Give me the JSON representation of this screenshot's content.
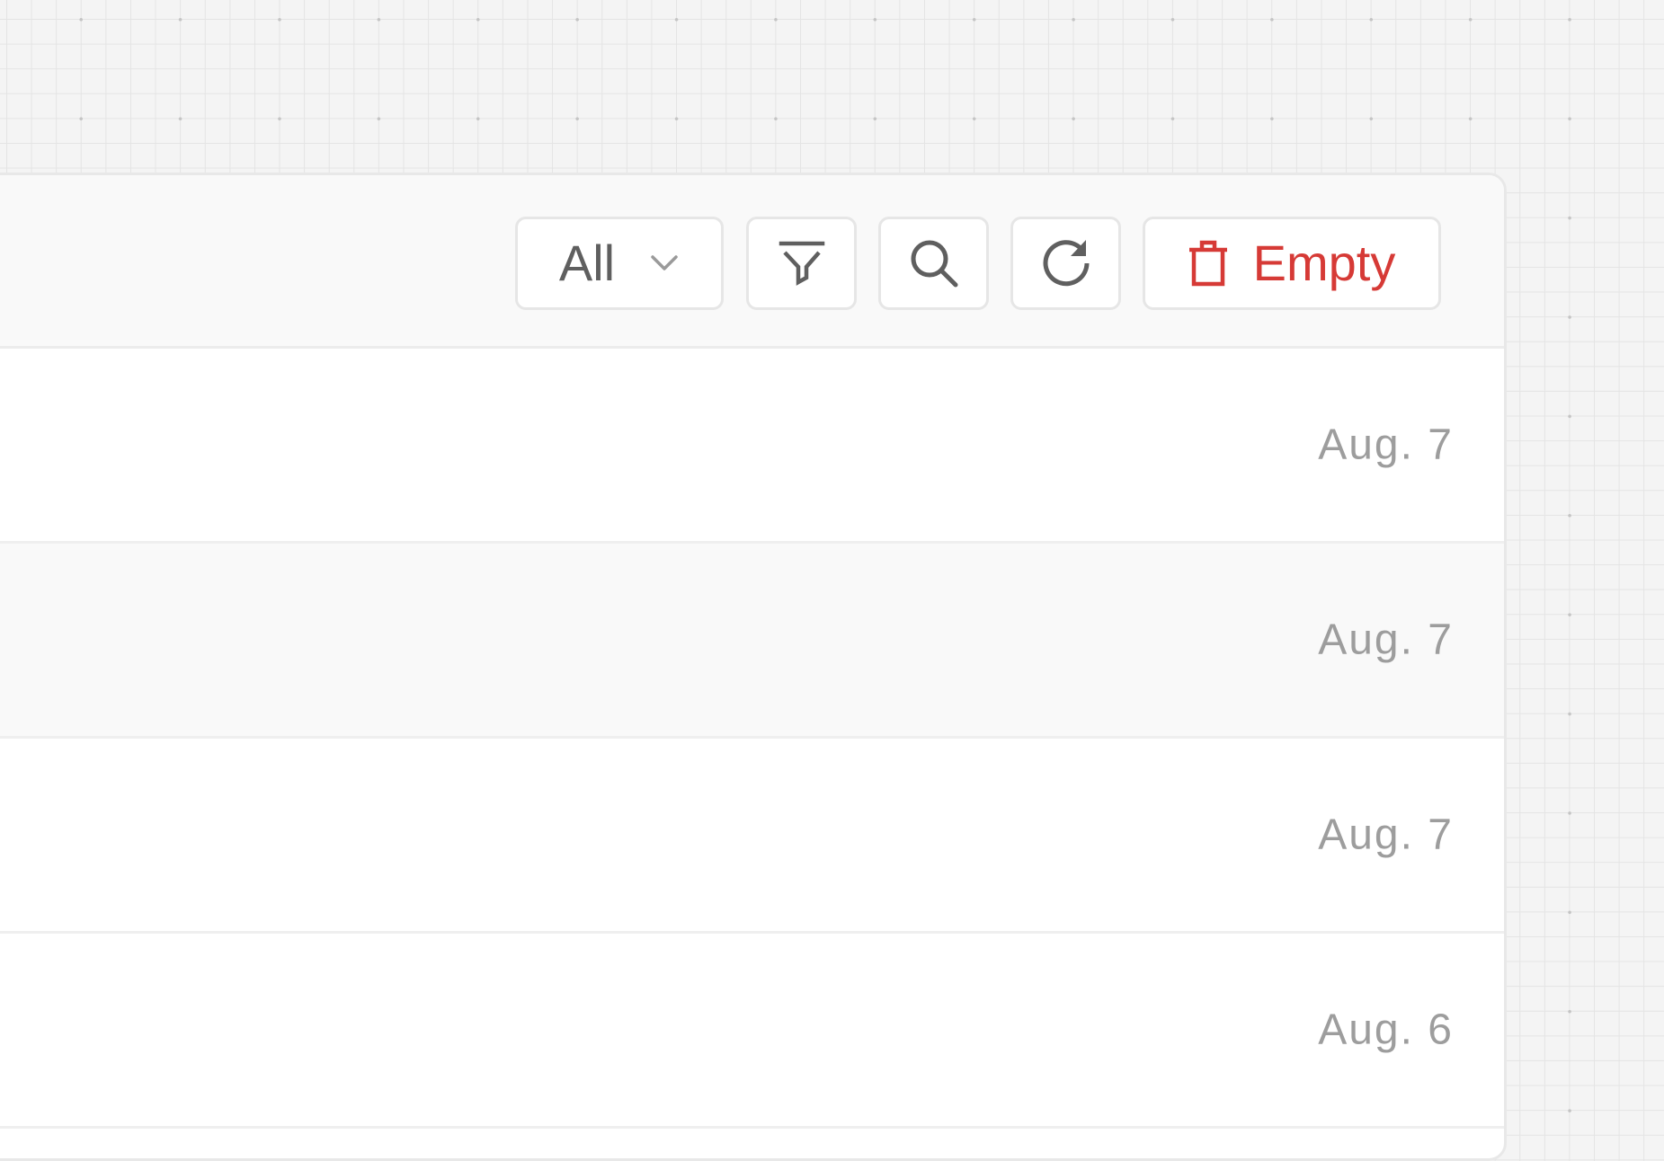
{
  "toolbar": {
    "filter_select": {
      "value": "All",
      "icon": "chevron-down-icon"
    },
    "filter_button_icon": "funnel-icon",
    "search_button_icon": "search-icon",
    "refresh_button_icon": "refresh-icon",
    "empty_button": {
      "label": "Empty",
      "icon": "trash-icon",
      "color": "#d63a36"
    }
  },
  "rows": [
    {
      "date": "Aug. 7"
    },
    {
      "date": "Aug. 7"
    },
    {
      "date": "Aug. 7"
    },
    {
      "date": "Aug. 6"
    }
  ],
  "colors": {
    "danger": "#d63a36",
    "row_alt_bg": "#f9f9f9",
    "date_text": "#9d9d9d",
    "icon": "#5f5f5f"
  }
}
